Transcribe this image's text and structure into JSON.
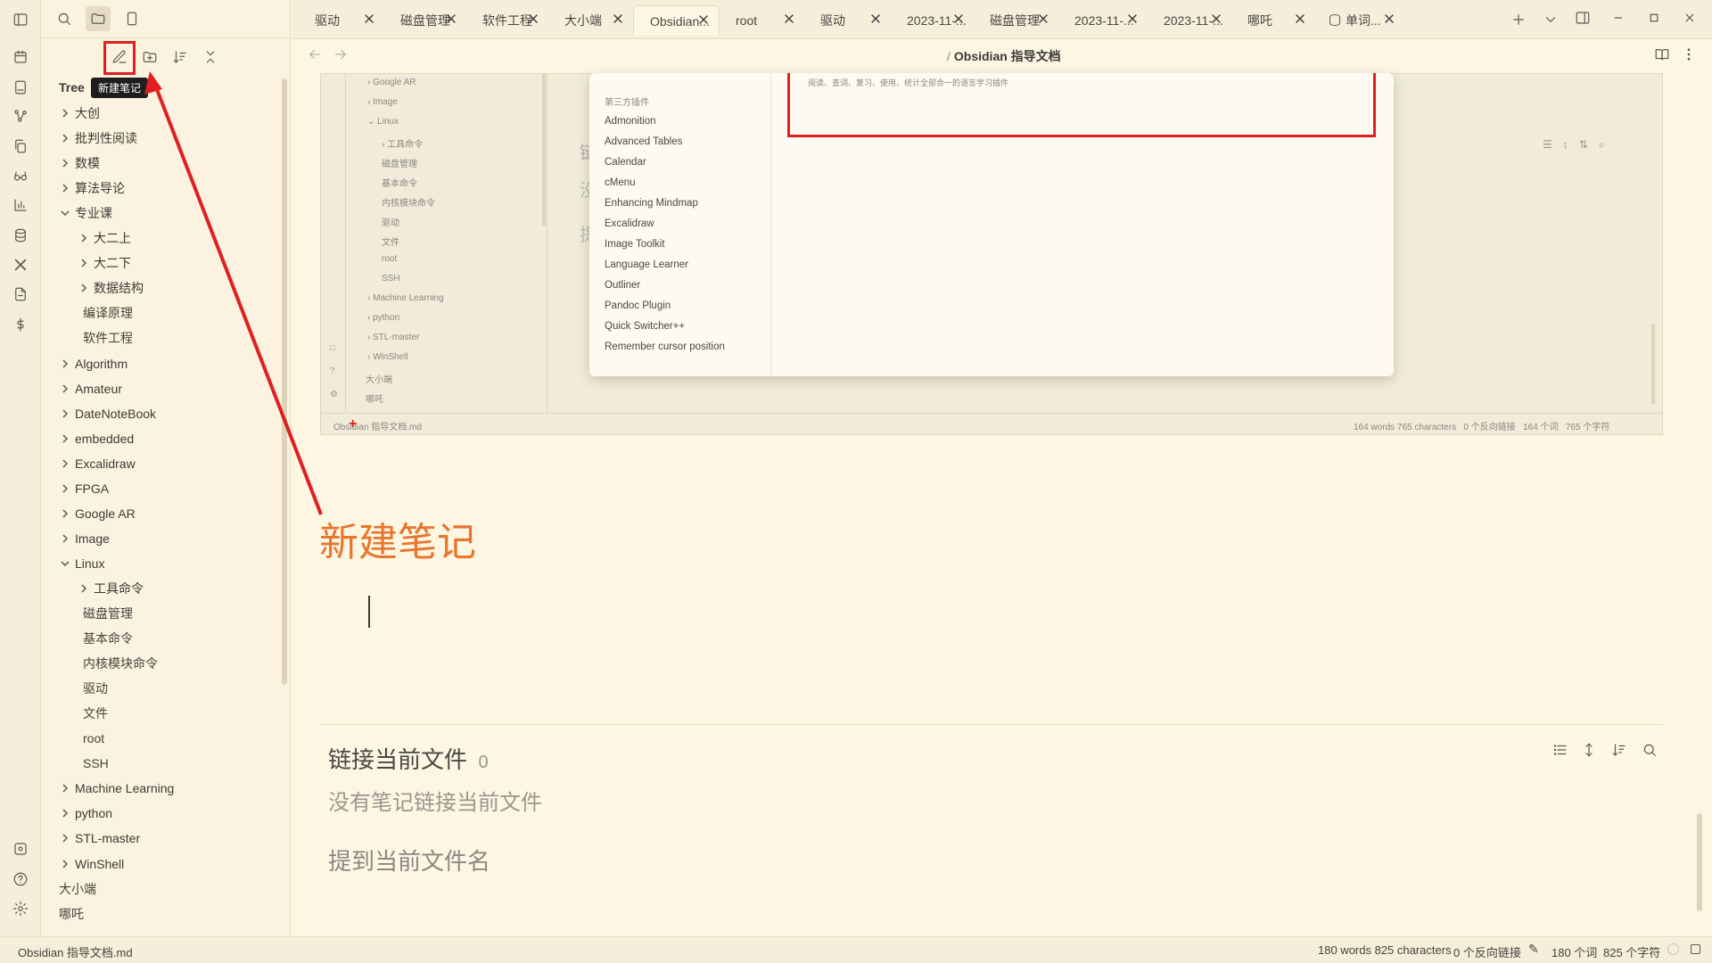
{
  "ribbon": {
    "top_icons": [
      "layout-sidebar-icon",
      "search-icon",
      "folder-icon",
      "bookmark-icon"
    ],
    "items": [
      "calendar-icon",
      "notebook-icon",
      "graph-icon",
      "copy-icon",
      "glasses-icon",
      "bar-chart-icon",
      "database-icon",
      "tools-icon",
      "file-export-icon",
      "dollar-icon"
    ],
    "bottom_icons": [
      "vault-icon",
      "help-icon",
      "settings-icon"
    ]
  },
  "explorer": {
    "toolbar_tooltip": "新建笔记",
    "tree_label": "Tree",
    "items": [
      {
        "label": "大创",
        "type": "folder",
        "open": false,
        "depth": 0
      },
      {
        "label": "批判性阅读",
        "type": "folder",
        "open": false,
        "depth": 0
      },
      {
        "label": "数模",
        "type": "folder",
        "open": false,
        "depth": 0
      },
      {
        "label": "算法导论",
        "type": "folder",
        "open": false,
        "depth": 0
      },
      {
        "label": "专业课",
        "type": "folder",
        "open": true,
        "depth": 0
      },
      {
        "label": "大二上",
        "type": "folder",
        "open": false,
        "depth": 1
      },
      {
        "label": "大二下",
        "type": "folder",
        "open": false,
        "depth": 1
      },
      {
        "label": "数据结构",
        "type": "folder",
        "open": false,
        "depth": 1
      },
      {
        "label": "编译原理",
        "type": "file",
        "depth": 1
      },
      {
        "label": "软件工程",
        "type": "file",
        "depth": 1
      },
      {
        "label": "Algorithm",
        "type": "folder",
        "open": false,
        "depth": 0
      },
      {
        "label": "Amateur",
        "type": "folder",
        "open": false,
        "depth": 0
      },
      {
        "label": "DateNoteBook",
        "type": "folder",
        "open": false,
        "depth": 0
      },
      {
        "label": "embedded",
        "type": "folder",
        "open": false,
        "depth": 0
      },
      {
        "label": "Excalidraw",
        "type": "folder",
        "open": false,
        "depth": 0
      },
      {
        "label": "FPGA",
        "type": "folder",
        "open": false,
        "depth": 0
      },
      {
        "label": "Google AR",
        "type": "folder",
        "open": false,
        "depth": 0
      },
      {
        "label": "Image",
        "type": "folder",
        "open": false,
        "depth": 0
      },
      {
        "label": "Linux",
        "type": "folder",
        "open": true,
        "depth": 0
      },
      {
        "label": "工具命令",
        "type": "folder",
        "open": false,
        "depth": 1
      },
      {
        "label": "磁盘管理",
        "type": "file",
        "depth": 1
      },
      {
        "label": "基本命令",
        "type": "file",
        "depth": 1
      },
      {
        "label": "内核模块命令",
        "type": "file",
        "depth": 1
      },
      {
        "label": "驱动",
        "type": "file",
        "depth": 1
      },
      {
        "label": "文件",
        "type": "file",
        "depth": 1
      },
      {
        "label": "root",
        "type": "file",
        "depth": 1
      },
      {
        "label": "SSH",
        "type": "file",
        "depth": 1
      },
      {
        "label": "Machine Learning",
        "type": "folder",
        "open": false,
        "depth": 0
      },
      {
        "label": "python",
        "type": "folder",
        "open": false,
        "depth": 0
      },
      {
        "label": "STL-master",
        "type": "folder",
        "open": false,
        "depth": 0
      },
      {
        "label": "WinShell",
        "type": "folder",
        "open": false,
        "depth": 0
      },
      {
        "label": "大小端",
        "type": "file",
        "depth": -1
      },
      {
        "label": "哪吒",
        "type": "file",
        "depth": -1
      }
    ]
  },
  "tabs": [
    {
      "label": "驱动",
      "active": false
    },
    {
      "label": "磁盘管理",
      "active": false
    },
    {
      "label": "软件工程",
      "active": false
    },
    {
      "label": "大小端",
      "active": false
    },
    {
      "label": "Obsidian...",
      "active": true
    },
    {
      "label": "root",
      "active": false
    },
    {
      "label": "驱动",
      "active": false
    },
    {
      "label": "2023-11-...",
      "active": false
    },
    {
      "label": "磁盘管理",
      "active": false
    },
    {
      "label": "2023-11-...",
      "active": false
    },
    {
      "label": "2023-11-...",
      "active": false
    },
    {
      "label": "哪吒",
      "active": false
    },
    {
      "label": "单词...",
      "active": false
    }
  ],
  "view_header": {
    "breadcrumb_sep": "/",
    "title": "Obsidian 指导文档"
  },
  "embedded_screenshot": {
    "tree_items": [
      "Google AR",
      "Image",
      "Linux",
      "工具命令",
      "磁盘管理",
      "基本命令",
      "内核模块命令",
      "驱动",
      "文件",
      "root",
      "SSH",
      "Machine Learning",
      "python",
      "STL-master",
      "WinShell",
      "大小端",
      "哪吒"
    ],
    "plugin_heading": "第三方插件",
    "plugins": [
      "Admonition",
      "Advanced Tables",
      "Calendar",
      "cMenu",
      "Enhancing Mindmap",
      "Excalidraw",
      "Image Toolkit",
      "Language Learner",
      "Outliner",
      "Pandoc Plugin",
      "Quick Switcher++",
      "Remember cursor position"
    ],
    "plugin_desc": "阅读、查词、复习、使用、统计全部合一的语言学习插件",
    "bg_chars": [
      "链",
      "没",
      "提"
    ],
    "status_left": "Obsidian 指导文档.md",
    "status_right": "164 words 765 characters   0 个反向链接   164 个词   765 个字符"
  },
  "note": {
    "heading": "新建笔记"
  },
  "backlinks": {
    "title": "链接当前文件",
    "count": "0",
    "empty": "没有笔记链接当前文件",
    "unlinked_title": "提到当前文件名"
  },
  "statusbar": {
    "file": "Obsidian 指导文档.md",
    "words_chars": "180 words 825 characters",
    "backlinks": "0 个反向链接",
    "word_count": "180 个词",
    "char_count": "825 个字符"
  },
  "colors": {
    "accent_orange": "#e8762d",
    "annotation_red": "#e02020",
    "bg": "#fdf6e3"
  }
}
